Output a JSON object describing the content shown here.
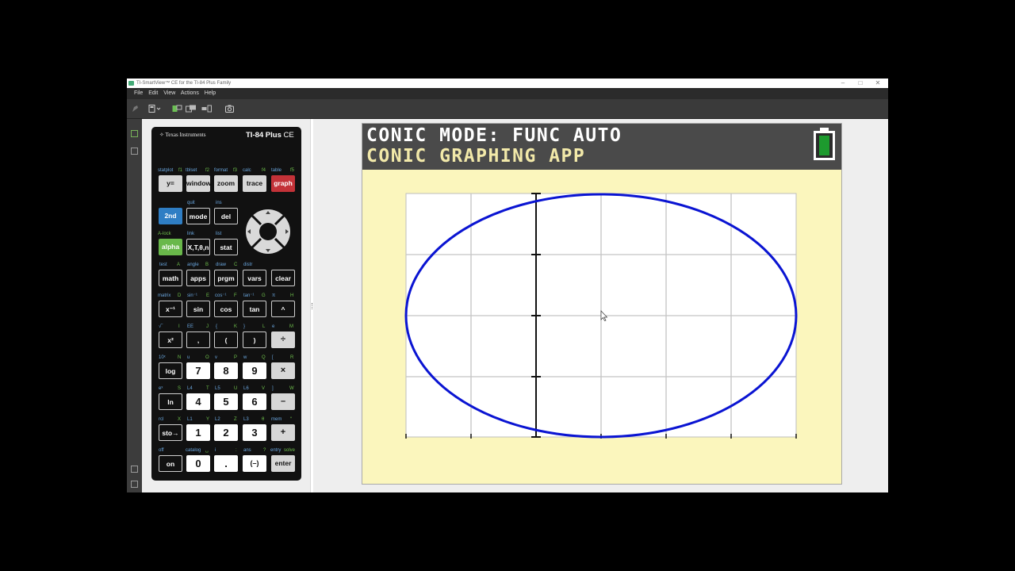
{
  "window": {
    "title": "TI-SmartView™ CE for the TI-84 Plus Family",
    "controls": {
      "minimize": "–",
      "maximize": "□",
      "close": "✕"
    }
  },
  "menu": [
    "File",
    "Edit",
    "View",
    "Actions",
    "Help"
  ],
  "toolbar": {
    "icons": [
      "pointer-icon",
      "calculator-view-icon",
      "send-to-device-icon",
      "key-press-history-icon",
      "emulator-layout-icon",
      "screenshot-camera-icon"
    ]
  },
  "leftstrip": {
    "icons": [
      "calculator-icon",
      "copy-icon",
      "grid-icon",
      "screen-icon"
    ]
  },
  "calculator": {
    "brand": "Texas Instruments",
    "model": "TI-84 Plus",
    "model_suffix": "CE",
    "keys": {
      "y_eq": "y=",
      "window": "window",
      "zoom": "zoom",
      "trace": "trace",
      "graph": "graph",
      "second": "2nd",
      "mode": "mode",
      "del": "del",
      "alpha": "alpha",
      "xton": "X,T,θ,n",
      "stat": "stat",
      "math": "math",
      "apps": "apps",
      "prgm": "prgm",
      "vars": "vars",
      "clear": "clear",
      "xinv": "x⁻¹",
      "sin": "sin",
      "cos": "cos",
      "tan": "tan",
      "caret": "^",
      "xsq": "x²",
      "comma": ",",
      "lparen": "(",
      "rparen": ")",
      "divide": "÷",
      "log": "log",
      "seven": "7",
      "eight": "8",
      "nine": "9",
      "times": "×",
      "ln": "ln",
      "four": "4",
      "five": "5",
      "six": "6",
      "minus": "–",
      "sto": "sto→",
      "one": "1",
      "two": "2",
      "three": "3",
      "plus": "+",
      "on": "on",
      "zero": "0",
      "dot": ".",
      "neg": "(–)",
      "enter": "enter"
    },
    "labels": {
      "statplot": "statplot",
      "f1": "f1",
      "tblset": "tblset",
      "f2": "f2",
      "format": "format",
      "f3": "f3",
      "calc": "calc",
      "f4": "f4",
      "table": "table",
      "f5": "f5",
      "quit": "quit",
      "ins": "ins",
      "alock": "A-lock",
      "link": "link",
      "list": "list",
      "test": "test",
      "A": "A",
      "angle": "angle",
      "B": "B",
      "draw": "draw",
      "C": "C",
      "distr": "distr",
      "matrix": "matrix",
      "D": "D",
      "sininv": "sin⁻¹",
      "E": "E",
      "cosinv": "cos⁻¹",
      "F": "F",
      "taninv": "tan⁻¹",
      "G": "G",
      "pi": "π",
      "H": "H",
      "sqrt": "√‾",
      "I": "I",
      "EE": "EE",
      "J": "J",
      "lbrace": "{",
      "K": "K",
      "rbrace": "}",
      "L": "L",
      "e": "e",
      "M": "M",
      "tenx": "10ˣ",
      "N": "N",
      "u": "u",
      "O": "O",
      "v": "v",
      "P": "P",
      "w": "w",
      "Q": "Q",
      "lbrack": "[",
      "R": "R",
      "ex": "eˣ",
      "S": "S",
      "L4": "L4",
      "T": "T",
      "L5": "L5",
      "U": "U",
      "L6": "L6",
      "V": "V",
      "rbrack": "]",
      "W": "W",
      "rcl": "rcl",
      "X": "X",
      "L1": "L1",
      "Y": "Y",
      "L2": "L2",
      "Z": "Z",
      "L3": "L3",
      "theta": "θ",
      "mem": "mem",
      "quote": "“",
      "off": "off",
      "catalog": "catalog",
      "space": "␣",
      "i": "i",
      "colon": ":",
      "ans": "ans",
      "question": "?",
      "entry": "entry",
      "solve": "solve"
    }
  },
  "screen": {
    "line1": "CONIC MODE: FUNC AUTO",
    "line2": "CONIC GRAPHING APP",
    "colors": {
      "header_bg": "#4a4a4a",
      "line1": "#ffffff",
      "line2": "#f2e9a9",
      "graph_bg": "#fbf6bd",
      "curve": "#0a14d2",
      "battery": "#1d9a2e"
    },
    "graph": {
      "curve_type": "ellipse",
      "grid": true,
      "vertical_axis": "shown"
    }
  }
}
